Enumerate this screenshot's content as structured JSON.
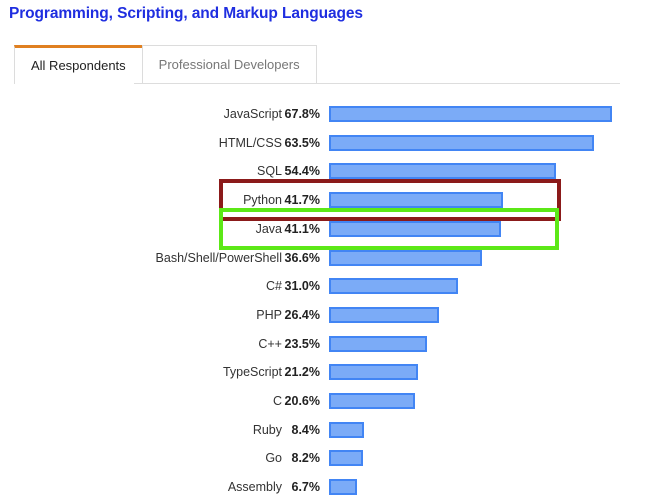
{
  "header": {
    "title": "Programming, Scripting, and Markup Languages"
  },
  "tabs": [
    {
      "label": "All Respondents",
      "active": true
    },
    {
      "label": "Professional Developers",
      "active": false
    }
  ],
  "colors": {
    "title": "#1f2ee0",
    "active_tab_underline": "#e08020",
    "bar_fill": "#7babf7",
    "bar_border": "#4285f4",
    "highlight_python": "#8b1a1a",
    "highlight_java": "#5ce817"
  },
  "highlights": [
    {
      "category": "Python",
      "color": "#8b1a1a",
      "style": "red"
    },
    {
      "category": "Java",
      "color": "#5ce817",
      "style": "green"
    }
  ],
  "chart_data": {
    "type": "bar",
    "orientation": "horizontal",
    "title": "Programming, Scripting, and Markup Languages",
    "xlabel": "",
    "ylabel": "",
    "xlim": [
      0,
      70
    ],
    "grid": false,
    "legend": null,
    "value_suffix": "%",
    "categories": [
      "JavaScript",
      "HTML/CSS",
      "SQL",
      "Python",
      "Java",
      "Bash/Shell/PowerShell",
      "C#",
      "PHP",
      "C++",
      "TypeScript",
      "C",
      "Ruby",
      "Go",
      "Assembly"
    ],
    "values": [
      67.8,
      63.5,
      54.4,
      41.7,
      41.1,
      36.6,
      31.0,
      26.4,
      23.5,
      21.2,
      20.6,
      8.4,
      8.2,
      6.7
    ],
    "value_labels": [
      "67.8%",
      "63.5%",
      "54.4%",
      "41.7%",
      "41.1%",
      "36.6%",
      "31.0%",
      "26.4%",
      "23.5%",
      "21.2%",
      "20.6%",
      "8.4%",
      "8.2%",
      "6.7%"
    ]
  }
}
